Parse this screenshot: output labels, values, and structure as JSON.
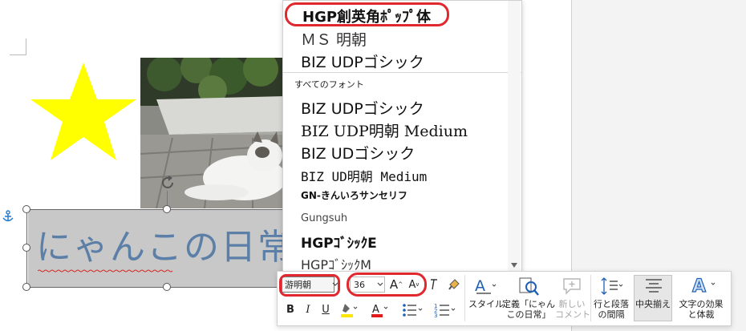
{
  "font_list": {
    "top_items": [
      {
        "name": "HGP創英角ﾎﾟｯﾌﾟ体",
        "highlighted": true
      },
      {
        "name": "ＭＳ 明朝"
      },
      {
        "name": "BIZ UDPゴシック"
      }
    ],
    "section_label": "すべてのフォント",
    "all_items": [
      "BIZ UDPゴシック",
      "BIZ UDP明朝 Medium",
      "BIZ UDゴシック",
      "BIZ UD明朝 Medium",
      "GN-きんいろサンセリフ",
      "Gungsuh",
      "HGPｺﾞｼｯｸE",
      "HGPｺﾞｼｯｸM"
    ]
  },
  "textbox": {
    "text": "にゃんこの日常"
  },
  "toolbar": {
    "font_name": "游明朝",
    "font_size": "36",
    "grow_font": "A",
    "shrink_font": "A",
    "bold": "B",
    "italic": "I",
    "underline": "U",
    "style_label": "スタイル",
    "define_label_1": "定義「にゃん",
    "define_label_2": "この日常」",
    "new_comment_1": "新しい",
    "new_comment_2": "コメント",
    "line_spacing_1": "行と段落",
    "line_spacing_2": "の間隔",
    "center_label": "中央揃え",
    "effects_1": "文字の効果",
    "effects_2": "と体裁"
  },
  "colors": {
    "accent_red": "#e0282e",
    "star": "#ffff00",
    "text_blue": "#5c7fa8",
    "highlight_yellow": "#ffe600",
    "font_color_red": "#e31b1b"
  }
}
